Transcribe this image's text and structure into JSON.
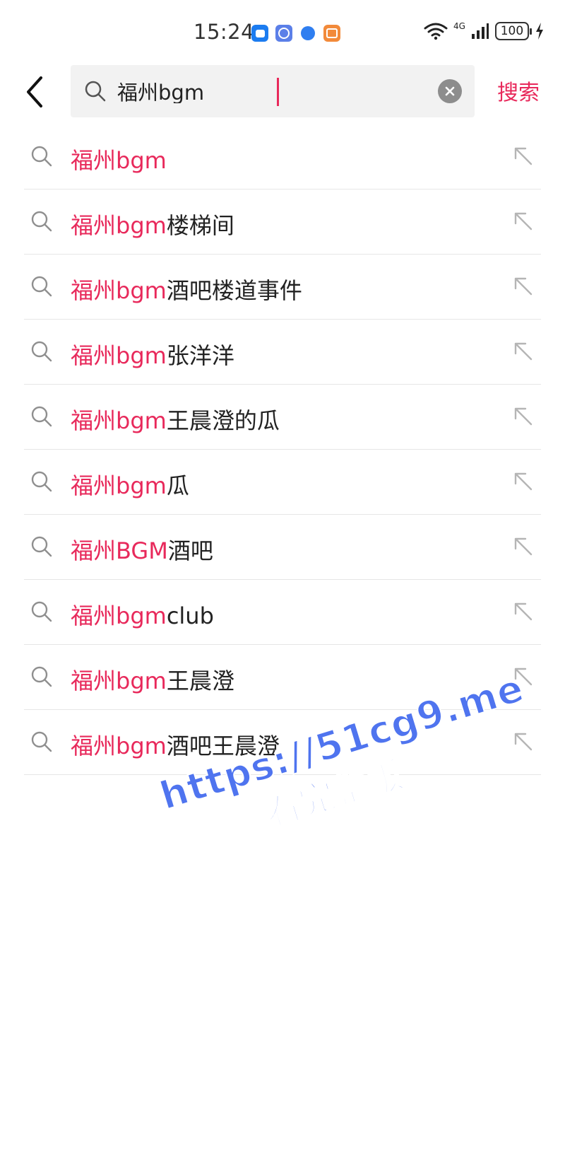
{
  "status_bar": {
    "time": "15:24",
    "network": "4G",
    "battery": "100"
  },
  "header": {
    "query": "福州bgm",
    "search_label": "搜索"
  },
  "suggestions": [
    {
      "highlight": "福州bgm",
      "rest": ""
    },
    {
      "highlight": "福州bgm",
      "rest": "楼梯间"
    },
    {
      "highlight": "福州bgm",
      "rest": "酒吧楼道事件"
    },
    {
      "highlight": "福州bgm",
      "rest": "张洋洋"
    },
    {
      "highlight": "福州bgm",
      "rest": "王晨澄的瓜"
    },
    {
      "highlight": "福州bgm",
      "rest": "瓜"
    },
    {
      "highlight": "福州BGM",
      "rest": "酒吧"
    },
    {
      "highlight": "福州bgm",
      "rest": "club"
    },
    {
      "highlight": "福州bgm",
      "rest": "王晨澄"
    },
    {
      "highlight": "福州bgm",
      "rest": "酒吧王晨澄"
    }
  ],
  "watermark": {
    "line1": "https://51cg9.me",
    "line2": "看完整版"
  },
  "colors": {
    "accent": "#e8295b",
    "watermark": "#4f74ef"
  },
  "icons": {
    "back": "chevron-left-icon",
    "search": "search-icon",
    "clear": "clear-icon",
    "fill": "arrow-up-left-icon"
  }
}
